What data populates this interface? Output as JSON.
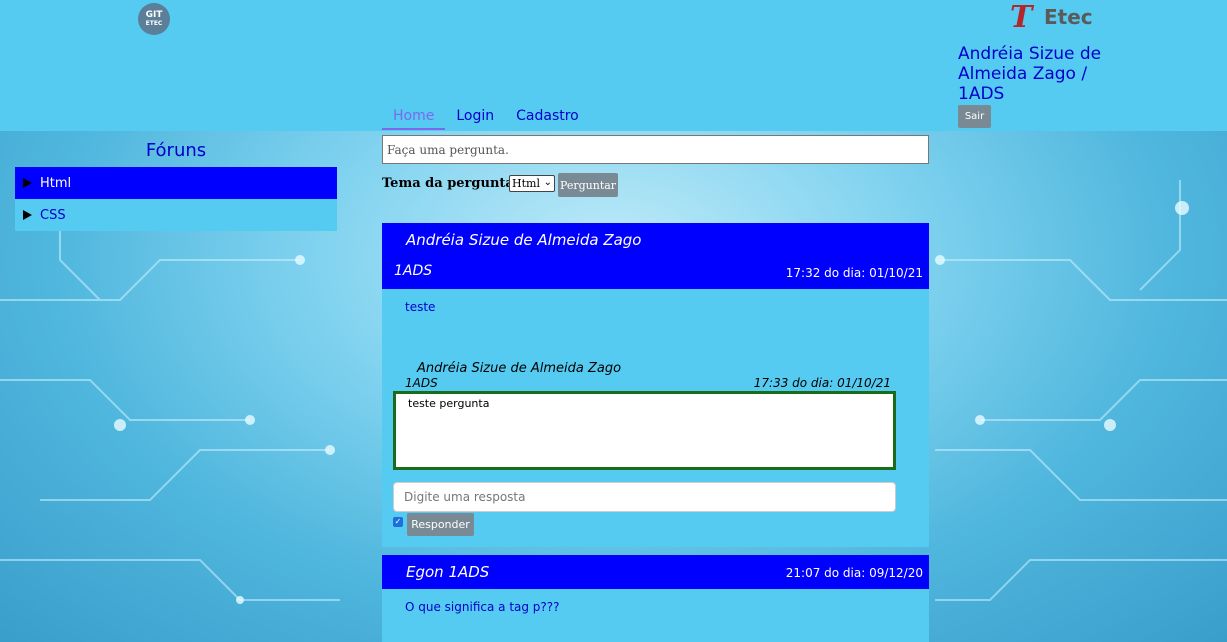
{
  "header": {
    "git_logo_line1": "GIT",
    "git_logo_line2": "ETEC",
    "etec_logo_letter": "T",
    "etec_logo_text": "Etec",
    "user_display": "Andréia Sizue de Almeida Zago / 1ADS",
    "logout_label": "Sair"
  },
  "nav": {
    "items": [
      {
        "label": "Home",
        "active": true
      },
      {
        "label": "Login",
        "active": false
      },
      {
        "label": "Cadastro",
        "active": false
      }
    ]
  },
  "sidebar": {
    "title": "Fóruns",
    "items": [
      {
        "label": "Html",
        "selected": true
      },
      {
        "label": "CSS",
        "selected": false
      }
    ]
  },
  "ask_form": {
    "placeholder": "Faça uma pergunta.",
    "topic_label": "Tema da pergunta:",
    "topic_selected": "Html",
    "submit_label": "Perguntar"
  },
  "posts": [
    {
      "author": "Andréia Sizue de Almeida Zago",
      "turma": "1ADS",
      "time": "17:32 do dia: 01/10/21",
      "body": "teste",
      "reply": {
        "author": "Andréia Sizue de Almeida Zago",
        "turma": "1ADS",
        "time": "17:33 do dia: 01/10/21",
        "body": "teste pergunta"
      },
      "answer_placeholder": "Digite uma resposta",
      "answer_checkbox_checked": true,
      "answer_button": "Responder"
    },
    {
      "author": "Egon 1ADS",
      "time": "21:07 do dia: 09/12/20",
      "body": "O que significa a tag p???"
    }
  ],
  "colors": {
    "header_bg": "#56cbf1",
    "post_head_bg": "#0000ff",
    "link_blue": "#0000cd",
    "button_gray": "#7a8a94",
    "reply_border": "#1a6b1a"
  }
}
